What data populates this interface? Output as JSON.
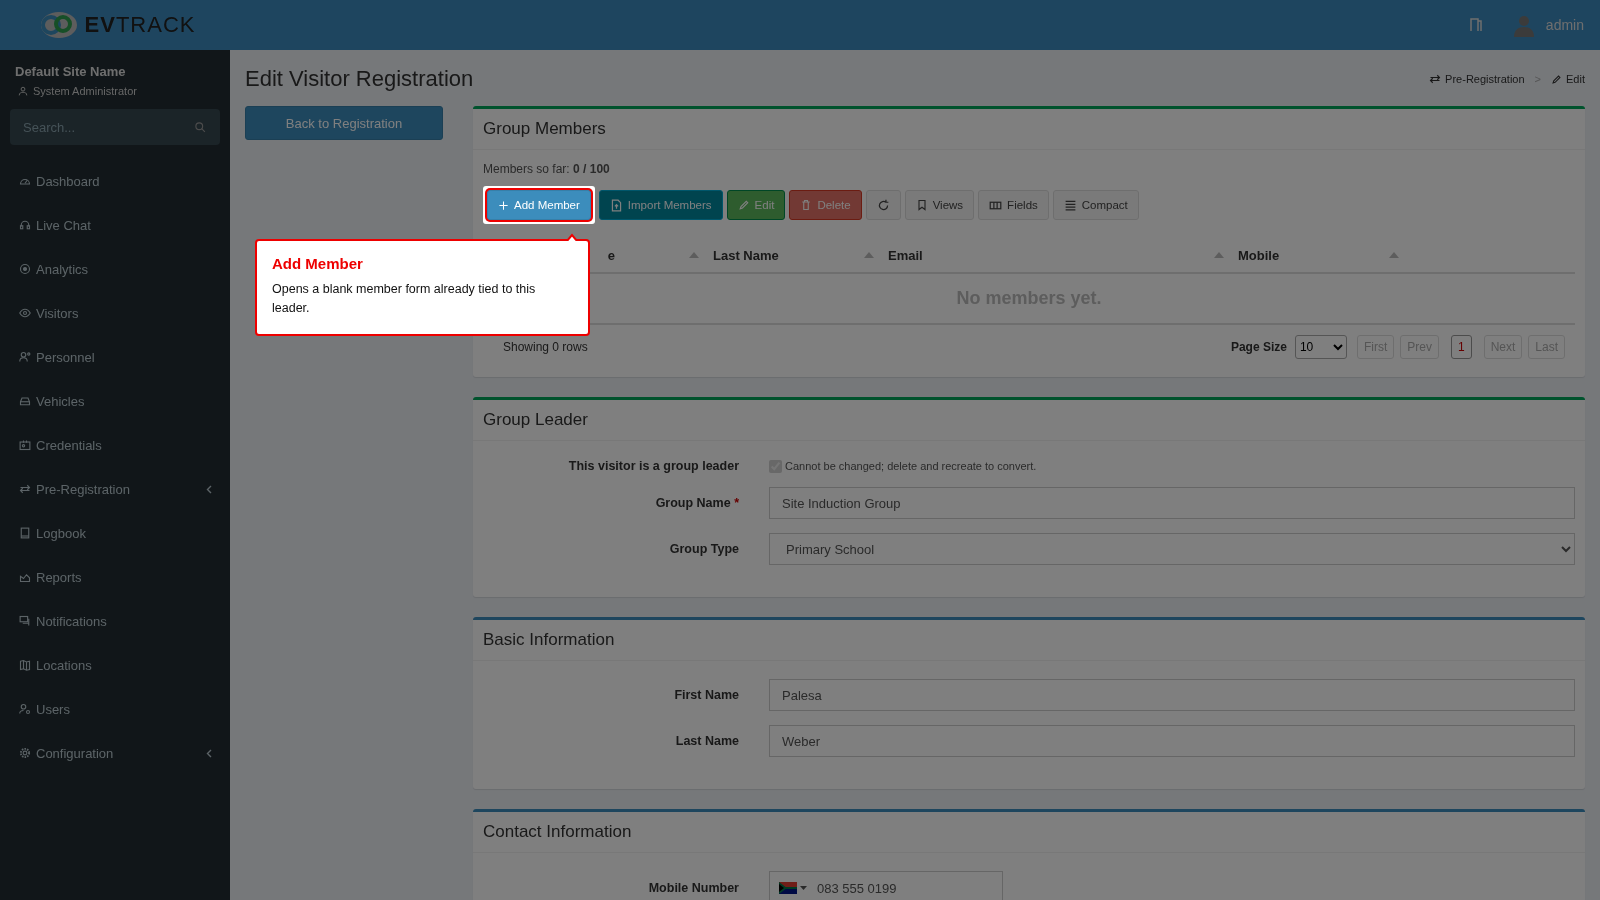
{
  "topbar": {
    "brand": "**EV**TRACK",
    "user": "admin"
  },
  "sidebar": {
    "site": "Default Site Name",
    "role": "System Administrator",
    "search": {
      "placeholder": "Search..."
    },
    "items": [
      {
        "label": "Dashboard",
        "expandable": false
      },
      {
        "label": "Live Chat",
        "expandable": false
      },
      {
        "label": "Analytics",
        "expandable": false
      },
      {
        "label": "Visitors",
        "expandable": false
      },
      {
        "label": "Personnel",
        "expandable": false
      },
      {
        "label": "Vehicles",
        "expandable": false
      },
      {
        "label": "Credentials",
        "expandable": false
      },
      {
        "label": "Pre-Registration",
        "expandable": true
      },
      {
        "label": "Logbook",
        "expandable": false
      },
      {
        "label": "Reports",
        "expandable": false
      },
      {
        "label": "Notifications",
        "expandable": false
      },
      {
        "label": "Locations",
        "expandable": false
      },
      {
        "label": "Users",
        "expandable": false
      },
      {
        "label": "Configuration",
        "expandable": true
      }
    ]
  },
  "page": {
    "title": "Edit Visitor Registration",
    "breadcrumb": [
      "Pre-Registration",
      "Edit"
    ],
    "breadcrumb_separator": ">",
    "back_button": "Back to Registration"
  },
  "group_members": {
    "title": "Group Members",
    "count": "Members so far: **0 / 100**",
    "toolbar": [
      {
        "label": "Add Member",
        "kind": "primary",
        "highlighted": true
      },
      {
        "label": "Import Members",
        "kind": "info",
        "highlighted": false
      },
      {
        "label": "Edit",
        "kind": "success",
        "highlighted": false
      },
      {
        "label": "Delete",
        "kind": "danger",
        "highlighted": false
      },
      {
        "kind": "refresh",
        "highlighted": false
      },
      {
        "label": "Views",
        "kind": "views",
        "highlighted": false
      },
      {
        "label": "Fields",
        "kind": "fields",
        "highlighted": false
      },
      {
        "label": "Compact",
        "kind": "compact",
        "highlighted": false
      }
    ],
    "columns": [
      "e",
      "Last Name",
      "Email",
      "Mobile"
    ],
    "empty_text": "No members yet.",
    "footer": "Showing 0 rows",
    "page_size_label": "Page Size",
    "page_size": "10",
    "pager": [
      {
        "label": "First",
        "selected": false
      },
      {
        "label": "Prev",
        "selected": false
      },
      {
        "label": "1",
        "selected": true
      },
      {
        "label": "Next",
        "selected": false
      },
      {
        "label": "Last",
        "selected": false
      }
    ]
  },
  "tooltip": {
    "title": "Add Member",
    "text": "Opens a blank member form already tied to this leader."
  },
  "sections": [
    {
      "title": "Group Leader",
      "kind": "group",
      "fields": [
        {
          "kind": "checkbox",
          "label": "This visitor is a group leader",
          "checked": true,
          "disabled": true,
          "hint": "Cannot be changed; delete and recreate to convert."
        },
        {
          "kind": "text",
          "label": "Group Name",
          "required_mark": "*",
          "value": "Site Induction Group"
        },
        {
          "kind": "select",
          "label": "Group Type",
          "value": "Primary School"
        }
      ]
    },
    {
      "title": "Basic Information",
      "kind": "info",
      "fields": [
        {
          "kind": "text",
          "label": "First Name",
          "value": "Palesa"
        },
        {
          "kind": "text",
          "label": "Last Name",
          "value": "Weber"
        }
      ]
    },
    {
      "title": "Contact Information",
      "kind": "info",
      "fields": [
        {
          "kind": "phone",
          "label": "Mobile Number",
          "value": "083 555 0199"
        }
      ]
    }
  ]
}
